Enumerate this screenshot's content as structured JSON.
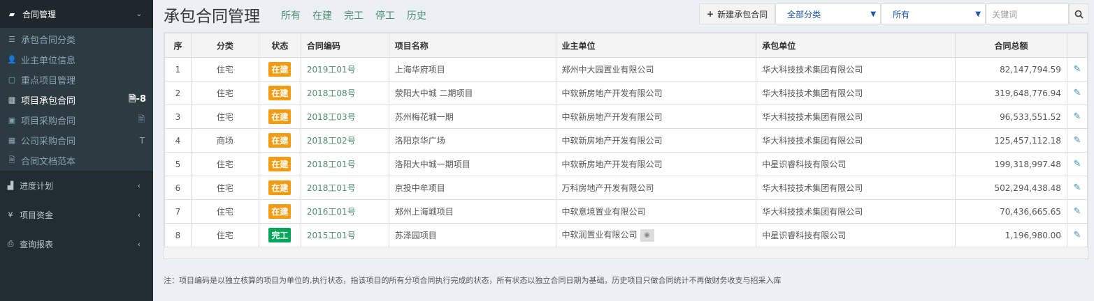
{
  "sidebar": {
    "head_label": "合同管理",
    "sub_items": [
      {
        "label": "承包合同分类"
      },
      {
        "label": "业主单位信息"
      },
      {
        "label": "重点项目管理"
      },
      {
        "label": "项目承包合同",
        "badge": "-8"
      },
      {
        "label": "项目采购合同"
      },
      {
        "label": "公司采购合同"
      },
      {
        "label": "合同文档范本"
      }
    ],
    "top_items": [
      {
        "label": "进度计划"
      },
      {
        "label": "项目资金"
      },
      {
        "label": "查询报表"
      }
    ]
  },
  "header": {
    "title": "承包合同管理",
    "filters": [
      "所有",
      "在建",
      "完工",
      "停工",
      "历史"
    ],
    "new_button": "新建承包合同",
    "category_select": "全部分类",
    "status_select": "所有",
    "search_placeholder": "关键词"
  },
  "table": {
    "columns": [
      "序",
      "分类",
      "状态",
      "合同编码",
      "项目名称",
      "业主单位",
      "承包单位",
      "合同总额",
      ""
    ],
    "rows": [
      {
        "no": "1",
        "category": "住宅",
        "status": "在建",
        "code": "2019工01号",
        "project": "上海华府项目",
        "owner": "郑州中大园置业有限公司",
        "contractor": "华大科技技术集团有限公司",
        "amount": "82,147,794.59"
      },
      {
        "no": "2",
        "category": "住宅",
        "status": "在建",
        "code": "2018工08号",
        "project": "荥阳大中城 二期项目",
        "owner": "中软新房地产开发有限公司",
        "contractor": "华大科技技术集团有限公司",
        "amount": "319,648,776.94"
      },
      {
        "no": "3",
        "category": "住宅",
        "status": "在建",
        "code": "2018工03号",
        "project": "苏州梅花城一期",
        "owner": "中软新房地产开发有限公司",
        "contractor": "华大科技技术集团有限公司",
        "amount": "96,533,551.52"
      },
      {
        "no": "4",
        "category": "商场",
        "status": "在建",
        "code": "2018工02号",
        "project": "洛阳京华广场",
        "owner": "中软新房地产开发有限公司",
        "contractor": "华大科技技术集团有限公司",
        "amount": "125,457,112.18"
      },
      {
        "no": "5",
        "category": "住宅",
        "status": "在建",
        "code": "2018工01号",
        "project": "洛阳大中城一期项目",
        "owner": "中软新房地产开发有限公司",
        "contractor": "中星识睿科技有限公司",
        "amount": "199,318,997.48"
      },
      {
        "no": "6",
        "category": "住宅",
        "status": "在建",
        "code": "2018工01号",
        "project": "京投中牟项目",
        "owner": "万科房地产开发有限公司",
        "contractor": "华大科技技术集团有限公司",
        "amount": "502,294,438.48"
      },
      {
        "no": "7",
        "category": "住宅",
        "status": "在建",
        "code": "2016工01号",
        "project": "郑州上海城项目",
        "owner": "中软意境置业有限公司",
        "contractor": "华大科技技术集团有限公司",
        "amount": "70,436,665.65"
      },
      {
        "no": "8",
        "category": "住宅",
        "status": "完工",
        "code": "2015工01号",
        "project": "苏泽园项目",
        "owner": "中软润置业有限公司",
        "contractor": "中星识睿科技有限公司",
        "amount": "1,196,980.00"
      }
    ]
  },
  "note": "注：项目编码是以独立核算的项目为单位的,执行状态，指该项目的所有分项合同执行完成的状态，所有状态以独立合同日期为基础。历史项目只做合同统计不再做财务收支与招采入库",
  "colors": {
    "in_progress": "#f39c12",
    "completed": "#00a65a",
    "link_green": "#4d8e6b"
  }
}
